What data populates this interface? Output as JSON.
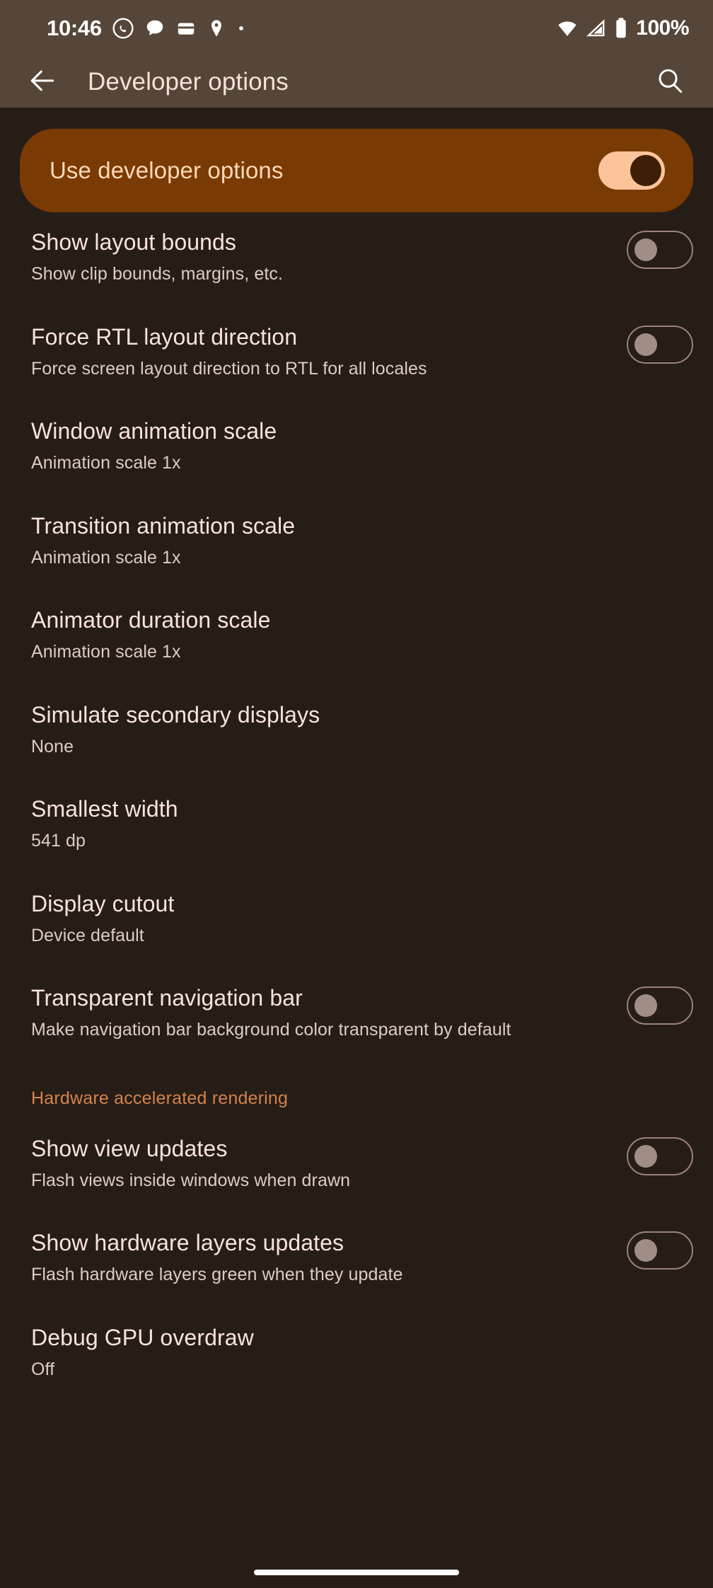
{
  "status_bar": {
    "time": "10:46",
    "battery_percent": "100%",
    "left_icons": [
      "whatsapp-icon",
      "chat-bubble-icon",
      "wallet-icon",
      "location-pin-icon",
      "dot-icon"
    ],
    "right_icons": [
      "wifi-icon",
      "cellular-signal-icon",
      "battery-icon"
    ]
  },
  "app_bar": {
    "back_icon": "back-arrow-icon",
    "title": "Developer options",
    "search_icon": "search-icon"
  },
  "master_toggle": {
    "label": "Use developer options",
    "state": "on"
  },
  "colors": {
    "background": "#261d17",
    "app_bar": "#554639",
    "card_accent": "#7a3a03",
    "title_text": "#f7e0d8",
    "section_header": "#d4834a",
    "switch_on_track": "#fbc49a"
  },
  "rows": [
    {
      "title": "Show layout bounds",
      "summary": "Show clip bounds, margins, etc.",
      "control": "switch",
      "state": "off"
    },
    {
      "title": "Force RTL layout direction",
      "summary": "Force screen layout direction to RTL for all locales",
      "control": "switch",
      "state": "off"
    },
    {
      "title": "Window animation scale",
      "summary": "Animation scale 1x",
      "control": "none",
      "state": ""
    },
    {
      "title": "Transition animation scale",
      "summary": "Animation scale 1x",
      "control": "none",
      "state": ""
    },
    {
      "title": "Animator duration scale",
      "summary": "Animation scale 1x",
      "control": "none",
      "state": ""
    },
    {
      "title": "Simulate secondary displays",
      "summary": "None",
      "control": "none",
      "state": ""
    },
    {
      "title": "Smallest width",
      "summary": "541 dp",
      "control": "none",
      "state": ""
    },
    {
      "title": "Display cutout",
      "summary": "Device default",
      "control": "none",
      "state": ""
    },
    {
      "title": "Transparent navigation bar",
      "summary": "Make navigation bar background color transparent by default",
      "control": "switch",
      "state": "off"
    }
  ],
  "section": {
    "header": "Hardware accelerated rendering",
    "rows": [
      {
        "title": "Show view updates",
        "summary": "Flash views inside windows when drawn",
        "control": "switch",
        "state": "off"
      },
      {
        "title": "Show hardware layers updates",
        "summary": "Flash hardware layers green when they update",
        "control": "switch",
        "state": "off"
      },
      {
        "title": "Debug GPU overdraw",
        "summary": "Off",
        "control": "none",
        "state": ""
      }
    ]
  },
  "nav_bar": {
    "handle": "gesture-home-handle"
  }
}
